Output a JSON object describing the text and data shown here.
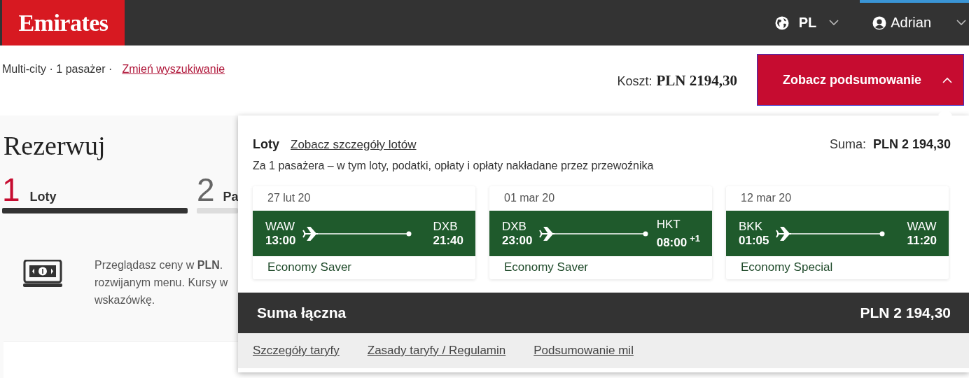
{
  "header": {
    "logo": "Emirates",
    "language": "PL",
    "user": "Adrian"
  },
  "search_bar": {
    "summary": "Multi-city · 1 pasażer ·",
    "change_link": "Zmień wyszukiwanie",
    "cost_label": "Koszt:",
    "cost": "PLN 2194,30",
    "summary_button": {
      "label": "Zobacz podsumowanie",
      "expanded": true
    }
  },
  "page": {
    "title": "Rezerwuj",
    "steps": [
      {
        "number": "1",
        "label": "Loty",
        "selected": true
      },
      {
        "number": "2",
        "label": "Pa",
        "selected": false
      }
    ],
    "currency_notice": [
      "Przeglądasz ceny w **PLN**.",
      "rozwijanym menu. Kursy w",
      "wskazówkę."
    ]
  },
  "summary": {
    "heading": "Loty",
    "details_link": "Zobacz szczegóły lotów",
    "total_label": "Suma:",
    "total": "PLN 2 194,30",
    "note": "Za 1 pasażera – w tym loty, podatki, opłaty i opłaty nakładane przez przewoźnika",
    "flights": [
      {
        "date": "27 lut 20",
        "from": "WAW",
        "depart": "13:00",
        "to": "DXB",
        "arrive": "21:40",
        "fare": "Economy Saver"
      },
      {
        "date": "01 mar 20",
        "from": "DXB",
        "depart": "23:00",
        "to": "HKT",
        "arrive": "08:00",
        "day_offset": "+1",
        "fare": "Economy Saver"
      },
      {
        "date": "12 mar 20",
        "from": "BKK",
        "depart": "01:05",
        "to": "WAW",
        "arrive": "11:20",
        "fare": "Economy Special"
      }
    ],
    "grand_total_label": "Suma łączna",
    "grand_total": "PLN 2 194,30",
    "links": [
      "Szczegóły taryfy",
      "Zasady taryfy / Regulamin",
      "Podsumowanie mil"
    ]
  }
}
